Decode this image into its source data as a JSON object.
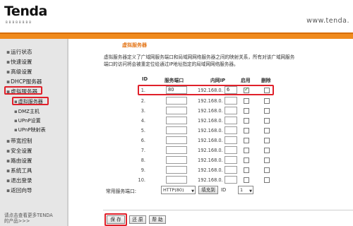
{
  "brand": {
    "logo": "Tenda",
    "logo_sub": "BBBBBBBB",
    "url": "www.tenda."
  },
  "sidebar": {
    "items": [
      {
        "label": "运行状态"
      },
      {
        "label": "快速设置"
      },
      {
        "label": "高级设置"
      },
      {
        "label": "DHCP服务器"
      },
      {
        "label": "虚拟服务器"
      },
      {
        "label": "虚拟服务器"
      },
      {
        "label": "DMZ主机"
      },
      {
        "label": "UPnP设置"
      },
      {
        "label": "UPnP映射表"
      },
      {
        "label": "带宽控制"
      },
      {
        "label": "安全设置"
      },
      {
        "label": "路由设置"
      },
      {
        "label": "系统工具"
      },
      {
        "label": "退出登录"
      },
      {
        "label": "返回向导"
      }
    ],
    "note_line1": "请点击查看更多TENDA",
    "note_line2": "的产品>>>"
  },
  "main": {
    "title": "虚拟服务器",
    "description": "虚拟服务器定义了广域网服务端口和局域网网络服务器之间的映射关系，所有对该广域网服务端口的访问将会被重定位给通过IP地址指定的局域网网络服务器。",
    "headers": {
      "id": "ID",
      "port": "服务端口",
      "ip": "内网IP",
      "enable": "启用",
      "delete": "删除"
    },
    "ip_prefix": "192.168.0.",
    "rows": [
      {
        "id": "1.",
        "port": "80",
        "ip": "6",
        "enabled": true
      },
      {
        "id": "2.",
        "port": "",
        "ip": "",
        "enabled": false
      },
      {
        "id": "3.",
        "port": "",
        "ip": "",
        "enabled": false
      },
      {
        "id": "4.",
        "port": "",
        "ip": "",
        "enabled": false
      },
      {
        "id": "5.",
        "port": "",
        "ip": "",
        "enabled": false
      },
      {
        "id": "6.",
        "port": "",
        "ip": "",
        "enabled": false
      },
      {
        "id": "7.",
        "port": "",
        "ip": "",
        "enabled": false
      },
      {
        "id": "8.",
        "port": "",
        "ip": "",
        "enabled": false
      },
      {
        "id": "9.",
        "port": "",
        "ip": "",
        "enabled": false
      },
      {
        "id": "10.",
        "port": "",
        "ip": "",
        "enabled": false
      }
    ],
    "common_port_label": "常用服务端口:",
    "common_port_value": "HTTP(80)",
    "fill_button": "填充到",
    "id_label": "ID",
    "id_value": "1"
  },
  "buttons": {
    "save": "保 存",
    "restore": "还 原",
    "help": "帮 助"
  },
  "colors": {
    "accent_orange": "#f08a1c",
    "highlight_red": "#e0202a"
  }
}
